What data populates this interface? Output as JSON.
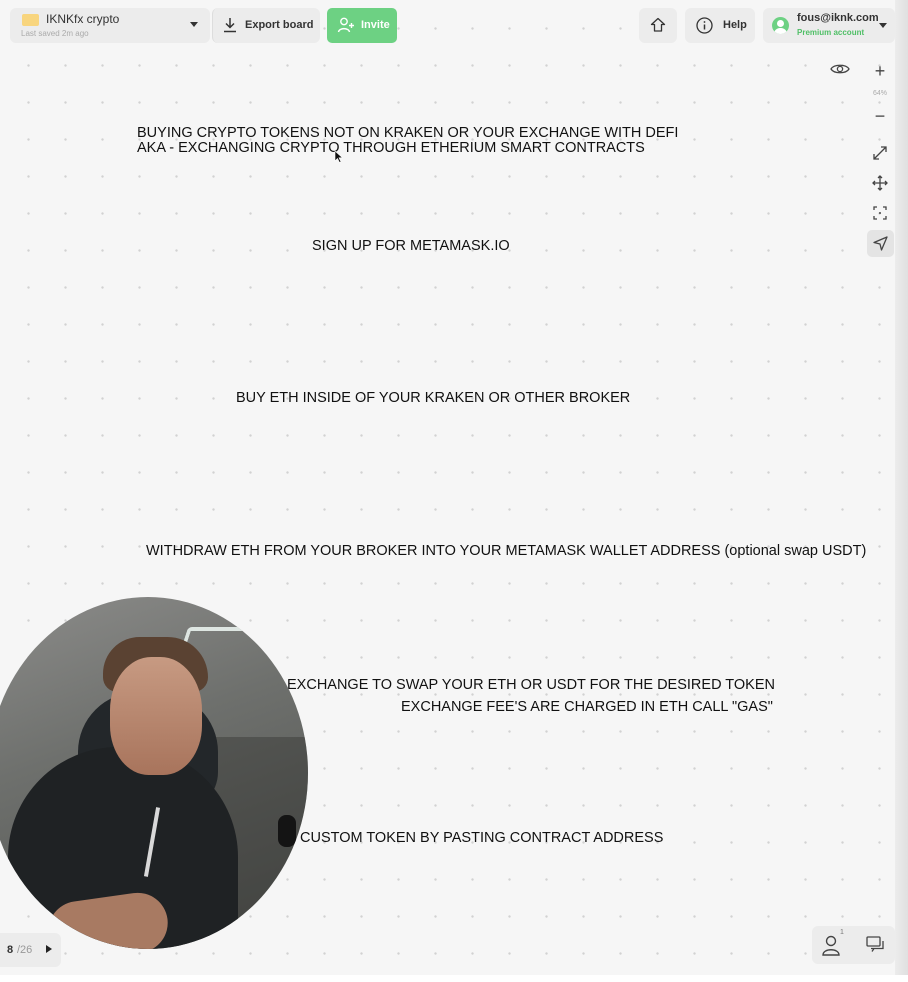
{
  "header": {
    "board_name": "IKNKfx crypto",
    "board_saved": "Last saved 2m ago",
    "export_label": "Export board",
    "invite_label": "Invite",
    "help_label": "Help",
    "account_email": "fous@iknk.com",
    "account_plan": "Premium account"
  },
  "tools": {
    "zoom_in": "+",
    "zoom_level": "64%",
    "zoom_out": "−",
    "icons": [
      "eye-icon",
      "plus-icon",
      "minus-icon",
      "expand-icon",
      "move-icon",
      "focus-icon",
      "navigate-icon"
    ]
  },
  "board": {
    "notes": [
      "BUYING CRYPTO TOKENS NOT ON KRAKEN OR YOUR EXCHANGE WITH DEFI",
      "AKA - EXCHANGING CRYPTO THROUGH ETHERIUM SMART CONTRACTS",
      "SIGN UP FOR METAMASK.IO",
      "BUY ETH INSIDE OF YOUR KRAKEN OR OTHER BROKER",
      "WITHDRAW ETH FROM YOUR BROKER INTO YOUR METAMASK WALLET ADDRESS (optional swap USDT)",
      "EXCHANGE TO SWAP YOUR ETH OR USDT FOR THE DESIRED TOKEN",
      "EXCHANGE FEE'S ARE CHARGED IN ETH CALL \"GAS\"",
      "CUSTOM TOKEN BY PASTING CONTRACT ADDRESS"
    ]
  },
  "footer": {
    "page_current": "8",
    "page_total": "/26",
    "collaborator_count": "1"
  },
  "colors": {
    "accent": "#6dd183",
    "plan_text": "#4fbf66",
    "canvas": "#f6f6f6",
    "folder": "#f8d57e"
  }
}
